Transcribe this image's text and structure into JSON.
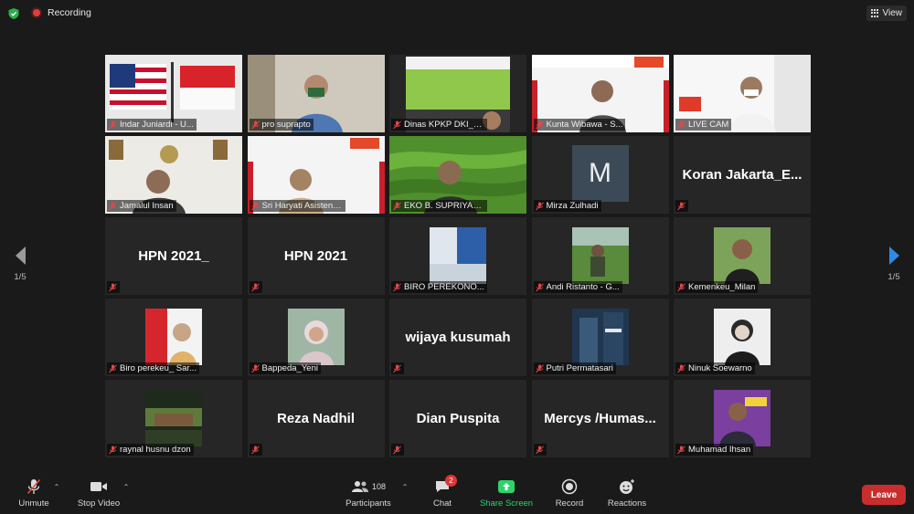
{
  "topbar": {
    "recording": "Recording",
    "view": "View"
  },
  "pagination": {
    "left": "1/5",
    "right": "1/5"
  },
  "tiles": [
    {
      "name": "Indar Juniardi - U...",
      "big": ""
    },
    {
      "name": "pro suprapto",
      "big": ""
    },
    {
      "name": "Dinas KPKP DKI_Eli...",
      "big": ""
    },
    {
      "name": "Kunta Wibawa - S...",
      "big": ""
    },
    {
      "name": "LIVE CAM",
      "big": ""
    },
    {
      "name": "Jamalul Insan",
      "big": ""
    },
    {
      "name": "Sri Haryati Asisten Pe...",
      "big": ""
    },
    {
      "name": "EKO B. SUPRIYAN...",
      "big": ""
    },
    {
      "name": "Mirza Zulhadi",
      "big": "",
      "avatar": "M"
    },
    {
      "name": "",
      "big": "Koran  Jakarta_E..."
    },
    {
      "name": "",
      "big": "HPN 2021_"
    },
    {
      "name": "",
      "big": "HPN 2021"
    },
    {
      "name": "BIRO PEREKONO...",
      "big": ""
    },
    {
      "name": "Andi Ristanto - G...",
      "big": ""
    },
    {
      "name": "Kemenkeu_Milan",
      "big": ""
    },
    {
      "name": "Biro perekeu_ Sar...",
      "big": ""
    },
    {
      "name": "Bappeda_Yeni",
      "big": ""
    },
    {
      "name": "",
      "big": "wijaya kusumah"
    },
    {
      "name": "Putri Permatasari",
      "big": ""
    },
    {
      "name": "Ninuk Soewarno",
      "big": ""
    },
    {
      "name": "raynal husnu dzon",
      "big": ""
    },
    {
      "name": "",
      "big": "Reza Nadhil"
    },
    {
      "name": "",
      "big": "Dian Puspita"
    },
    {
      "name": "",
      "big": "Mercys  /Humas..."
    },
    {
      "name": "Muhamad Ihsan",
      "big": ""
    }
  ],
  "toolbar": {
    "unmute": "Unmute",
    "stop_video": "Stop Video",
    "participants": "Participants",
    "participants_count": "108",
    "chat": "Chat",
    "chat_badge": "2",
    "share": "Share Screen",
    "record": "Record",
    "reactions": "Reactions",
    "leave": "Leave"
  },
  "colors": {
    "active_outline": "#d9e05a",
    "share_green": "#2fd36a",
    "leave_red": "#c92e2e",
    "rec_red": "#e23b3b"
  }
}
